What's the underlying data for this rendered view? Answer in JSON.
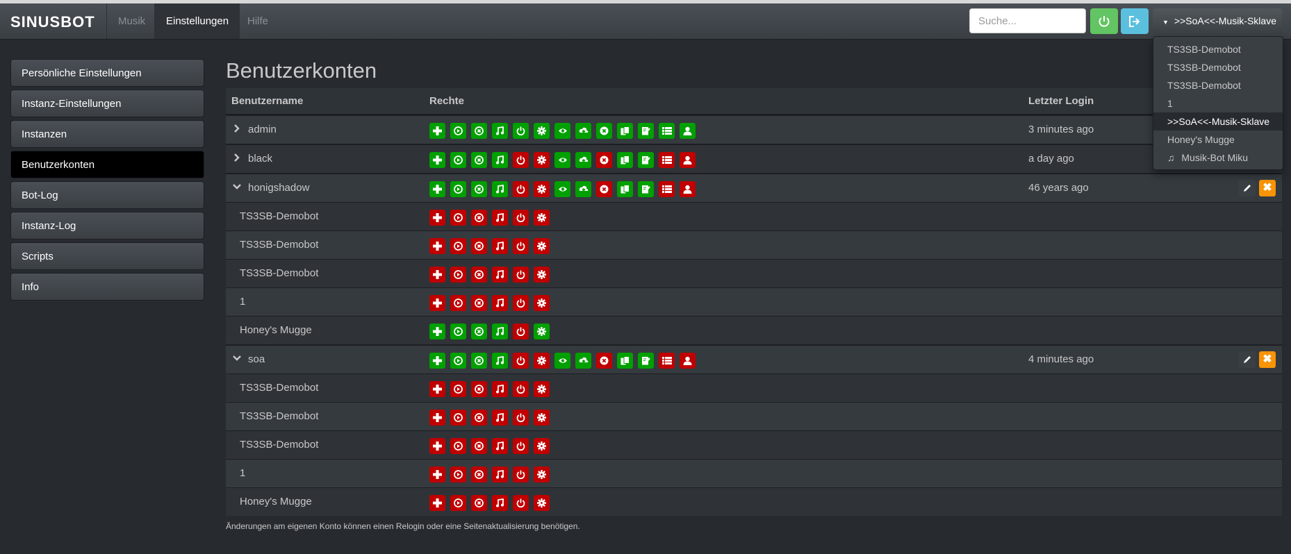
{
  "app": {
    "brand": "SINUSBOT"
  },
  "nav": {
    "tabs": [
      {
        "label": "Musik",
        "active": false
      },
      {
        "label": "Einstellungen",
        "active": true
      },
      {
        "label": "Hilfe",
        "active": false
      }
    ],
    "search_placeholder": "Suche...",
    "instance_label": ">>SoA<<-Musik-Sklave"
  },
  "instance_dropdown": {
    "items": [
      "TS3SB-Demobot",
      "TS3SB-Demobot",
      "TS3SB-Demobot",
      "1",
      ">>SoA<<-Musik-Sklave",
      "Honey's Mugge",
      "Musik-Bot Miku"
    ],
    "selected_index": 4
  },
  "sidebar": {
    "items": [
      {
        "label": "Persönliche Einstellungen",
        "active": false
      },
      {
        "label": "Instanz-Einstellungen",
        "active": false
      },
      {
        "label": "Instanzen",
        "active": false
      },
      {
        "label": "Benutzerkonten",
        "active": true
      },
      {
        "label": "Bot-Log",
        "active": false
      },
      {
        "label": "Instanz-Log",
        "active": false
      },
      {
        "label": "Scripts",
        "active": false
      },
      {
        "label": "Info",
        "active": false
      }
    ]
  },
  "main": {
    "title": "Benutzerkonten",
    "columns": {
      "username": "Benutzername",
      "rights": "Rechte",
      "last_login": "Letzter Login"
    },
    "footnote": "Änderungen am eigenen Konto können einen Relogin oder eine Seitenaktualisierung benötigen."
  },
  "permission_icons": [
    "plus-icon",
    "play-icon",
    "stop-icon",
    "music-icon",
    "power-icon",
    "gear-icon",
    "eye-icon",
    "upload-icon",
    "remove-icon",
    "files-icon",
    "file-edit-icon",
    "list-icon",
    "user-icon"
  ],
  "colors": {
    "granted": "#00a000",
    "denied": "#c00000",
    "delete": "#f89406"
  },
  "users": [
    {
      "name": "admin",
      "expanded": false,
      "last_login": "3 minutes ago",
      "rights": [
        1,
        1,
        1,
        1,
        1,
        1,
        1,
        1,
        1,
        1,
        1,
        1,
        1
      ],
      "instances": []
    },
    {
      "name": "black",
      "expanded": false,
      "last_login": "a day ago",
      "rights": [
        1,
        1,
        1,
        1,
        0,
        0,
        1,
        1,
        0,
        1,
        1,
        0,
        0
      ],
      "instances": []
    },
    {
      "name": "honigshadow",
      "expanded": true,
      "last_login": "46 years ago",
      "rights": [
        1,
        1,
        1,
        1,
        0,
        0,
        1,
        1,
        0,
        1,
        1,
        0,
        0
      ],
      "instances": [
        {
          "name": "TS3SB-Demobot",
          "rights": [
            0,
            0,
            0,
            0,
            0,
            0
          ]
        },
        {
          "name": "TS3SB-Demobot",
          "rights": [
            0,
            0,
            0,
            0,
            0,
            0
          ]
        },
        {
          "name": "TS3SB-Demobot",
          "rights": [
            0,
            0,
            0,
            0,
            0,
            0
          ]
        },
        {
          "name": "1",
          "rights": [
            0,
            0,
            0,
            0,
            0,
            0
          ]
        },
        {
          "name": "Honey's Mugge",
          "rights": [
            1,
            1,
            1,
            1,
            0,
            1
          ]
        }
      ]
    },
    {
      "name": "soa",
      "expanded": true,
      "last_login": "4 minutes ago",
      "rights": [
        1,
        1,
        1,
        1,
        0,
        0,
        1,
        1,
        0,
        1,
        1,
        0,
        0
      ],
      "instances": [
        {
          "name": "TS3SB-Demobot",
          "rights": [
            0,
            0,
            0,
            0,
            0,
            0
          ]
        },
        {
          "name": "TS3SB-Demobot",
          "rights": [
            0,
            0,
            0,
            0,
            0,
            0
          ]
        },
        {
          "name": "TS3SB-Demobot",
          "rights": [
            0,
            0,
            0,
            0,
            0,
            0
          ]
        },
        {
          "name": "1",
          "rights": [
            0,
            0,
            0,
            0,
            0,
            0
          ]
        },
        {
          "name": "Honey's Mugge",
          "rights": [
            0,
            0,
            0,
            0,
            0,
            0
          ]
        }
      ]
    }
  ]
}
